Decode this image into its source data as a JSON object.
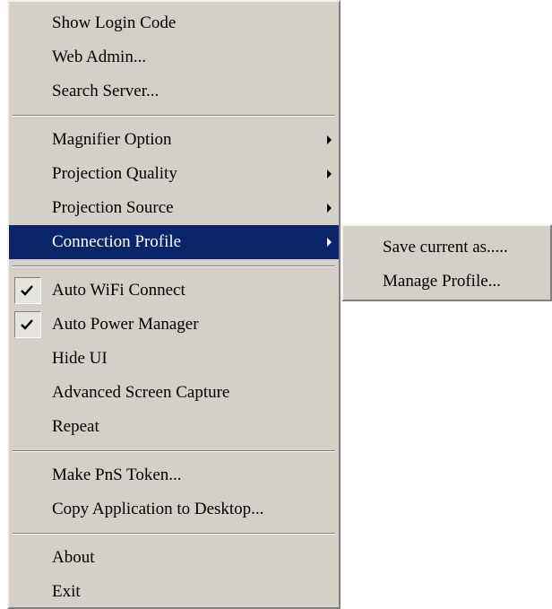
{
  "main_menu": {
    "items": [
      {
        "label": "Show Login Code"
      },
      {
        "label": "Web Admin..."
      },
      {
        "label": "Search Server..."
      },
      {
        "label": "Magnifier Option"
      },
      {
        "label": "Projection Quality"
      },
      {
        "label": "Projection Source"
      },
      {
        "label": "Connection Profile"
      },
      {
        "label": "Auto WiFi Connect",
        "checked": true
      },
      {
        "label": "Auto Power Manager",
        "checked": true
      },
      {
        "label": "Hide UI"
      },
      {
        "label": "Advanced Screen Capture"
      },
      {
        "label": "Repeat"
      },
      {
        "label": "Make PnS Token..."
      },
      {
        "label": "Copy Application to Desktop..."
      },
      {
        "label": "About"
      },
      {
        "label": "Exit"
      }
    ]
  },
  "submenu": {
    "items": [
      {
        "label": "Save current as....."
      },
      {
        "label": "Manage Profile..."
      }
    ]
  },
  "colors": {
    "menu_background": "#d4d0c8",
    "highlight_background": "#0a246a",
    "highlight_text": "#ffffff"
  }
}
